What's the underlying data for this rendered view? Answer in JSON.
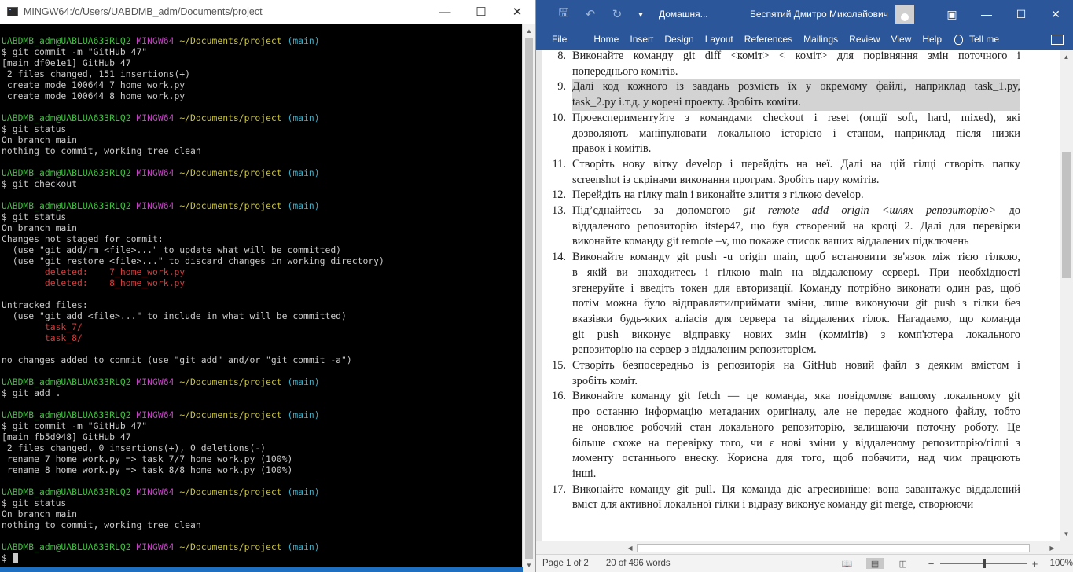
{
  "terminal": {
    "title": "MINGW64:/c/Users/UABDMB_adm/Documents/project",
    "lines": [
      [
        {
          "t": "UABDMB_adm@UABLUA633RLQ2 ",
          "c": "green"
        },
        {
          "t": "MINGW64 ",
          "c": "magenta"
        },
        {
          "t": "~/Documents/project ",
          "c": "yellow"
        },
        {
          "t": "(main)",
          "c": "cyan"
        }
      ],
      [
        {
          "t": "$ git commit -m \"GitHub_47\""
        }
      ],
      [
        {
          "t": "[main df0e1e1] GitHub_47"
        }
      ],
      [
        {
          "t": " 2 files changed, 151 insertions(+)"
        }
      ],
      [
        {
          "t": " create mode 100644 7_home_work.py"
        }
      ],
      [
        {
          "t": " create mode 100644 8_home_work.py"
        }
      ],
      [
        {
          "t": ""
        }
      ],
      [
        {
          "t": "UABDMB_adm@UABLUA633RLQ2 ",
          "c": "green"
        },
        {
          "t": "MINGW64 ",
          "c": "magenta"
        },
        {
          "t": "~/Documents/project ",
          "c": "yellow"
        },
        {
          "t": "(main)",
          "c": "cyan"
        }
      ],
      [
        {
          "t": "$ git status"
        }
      ],
      [
        {
          "t": "On branch main"
        }
      ],
      [
        {
          "t": "nothing to commit, working tree clean"
        }
      ],
      [
        {
          "t": ""
        }
      ],
      [
        {
          "t": "UABDMB_adm@UABLUA633RLQ2 ",
          "c": "green"
        },
        {
          "t": "MINGW64 ",
          "c": "magenta"
        },
        {
          "t": "~/Documents/project ",
          "c": "yellow"
        },
        {
          "t": "(main)",
          "c": "cyan"
        }
      ],
      [
        {
          "t": "$ git checkout"
        }
      ],
      [
        {
          "t": ""
        }
      ],
      [
        {
          "t": "UABDMB_adm@UABLUA633RLQ2 ",
          "c": "green"
        },
        {
          "t": "MINGW64 ",
          "c": "magenta"
        },
        {
          "t": "~/Documents/project ",
          "c": "yellow"
        },
        {
          "t": "(main)",
          "c": "cyan"
        }
      ],
      [
        {
          "t": "$ git status"
        }
      ],
      [
        {
          "t": "On branch main"
        }
      ],
      [
        {
          "t": "Changes not staged for commit:"
        }
      ],
      [
        {
          "t": "  (use \"git add/rm <file>...\" to update what will be committed)"
        }
      ],
      [
        {
          "t": "  (use \"git restore <file>...\" to discard changes in working directory)"
        }
      ],
      [
        {
          "t": "        deleted:    7_home_work.py",
          "c": "red"
        }
      ],
      [
        {
          "t": "        deleted:    8_home_work.py",
          "c": "red"
        }
      ],
      [
        {
          "t": ""
        }
      ],
      [
        {
          "t": "Untracked files:"
        }
      ],
      [
        {
          "t": "  (use \"git add <file>...\" to include in what will be committed)"
        }
      ],
      [
        {
          "t": "        task_7/",
          "c": "red"
        }
      ],
      [
        {
          "t": "        task_8/",
          "c": "red"
        }
      ],
      [
        {
          "t": ""
        }
      ],
      [
        {
          "t": "no changes added to commit (use \"git add\" and/or \"git commit -a\")"
        }
      ],
      [
        {
          "t": ""
        }
      ],
      [
        {
          "t": "UABDMB_adm@UABLUA633RLQ2 ",
          "c": "green"
        },
        {
          "t": "MINGW64 ",
          "c": "magenta"
        },
        {
          "t": "~/Documents/project ",
          "c": "yellow"
        },
        {
          "t": "(main)",
          "c": "cyan"
        }
      ],
      [
        {
          "t": "$ git add ."
        }
      ],
      [
        {
          "t": ""
        }
      ],
      [
        {
          "t": "UABDMB_adm@UABLUA633RLQ2 ",
          "c": "green"
        },
        {
          "t": "MINGW64 ",
          "c": "magenta"
        },
        {
          "t": "~/Documents/project ",
          "c": "yellow"
        },
        {
          "t": "(main)",
          "c": "cyan"
        }
      ],
      [
        {
          "t": "$ git commit -m \"GitHub_47\""
        }
      ],
      [
        {
          "t": "[main fb5d948] GitHub_47"
        }
      ],
      [
        {
          "t": " 2 files changed, 0 insertions(+), 0 deletions(-)"
        }
      ],
      [
        {
          "t": " rename 7_home_work.py => task_7/7_home_work.py (100%)"
        }
      ],
      [
        {
          "t": " rename 8_home_work.py => task_8/8_home_work.py (100%)"
        }
      ],
      [
        {
          "t": ""
        }
      ],
      [
        {
          "t": "UABDMB_adm@UABLUA633RLQ2 ",
          "c": "green"
        },
        {
          "t": "MINGW64 ",
          "c": "magenta"
        },
        {
          "t": "~/Documents/project ",
          "c": "yellow"
        },
        {
          "t": "(main)",
          "c": "cyan"
        }
      ],
      [
        {
          "t": "$ git status"
        }
      ],
      [
        {
          "t": "On branch main"
        }
      ],
      [
        {
          "t": "nothing to commit, working tree clean"
        }
      ],
      [
        {
          "t": ""
        }
      ],
      [
        {
          "t": "UABDMB_adm@UABLUA633RLQ2 ",
          "c": "green"
        },
        {
          "t": "MINGW64 ",
          "c": "magenta"
        },
        {
          "t": "~/Documents/project ",
          "c": "yellow"
        },
        {
          "t": "(main)",
          "c": "cyan"
        }
      ],
      [
        {
          "t": "$ ",
          "cursor": true
        }
      ]
    ]
  },
  "word": {
    "doc_title": "Домашня...",
    "user_name": "Беспятий Дмитро Миколайович",
    "tabs": [
      "File",
      "Home",
      "Insert",
      "Design",
      "Layout",
      "References",
      "Mailings",
      "Review",
      "View",
      "Help"
    ],
    "tell_me": "Tell me",
    "items": [
      {
        "num": "8.",
        "lines": [
          "Виконайте команду git diff  <коміт> < коміт> для порівняння змін поточного і",
          "попереднього комітів."
        ]
      },
      {
        "num": "9.",
        "highlight": true,
        "lines": [
          "Далі код кожного із завдань розмість їх у окремому файлі, наприклад  task_1.py,",
          "task_2.py і.т.д. у корені проекту. Зробіть коміти."
        ]
      },
      {
        "num": "10.",
        "lines": [
          "Проекспериментуйте з командами checkout і reset (опції soft, hard, mixed), які",
          "дозволяють маніпулювати локальною історією і станом, наприклад після низки",
          "правок і комітів."
        ]
      },
      {
        "num": "11.",
        "lines": [
          "Створіть нову вітку develop і перейдіть на неї. Далі на цій гілці створіть папку",
          "screenshot із скрінами виконання програм. Зробіть пару комітів."
        ]
      },
      {
        "num": "12.",
        "lines": [
          "Перейдіть на гілку main і виконайте злиття з гілкою develop."
        ]
      },
      {
        "num": "13.",
        "lines": [
          "Під’єднайтесь за допомогою <i>git remote add origin &lt;шлях репозиторію&gt;</i> до",
          "віддаленого репозиторію itstep47, що був створений на кроці 2. Далі для перевірки",
          "виконайте команду git remote –v, що покаже список ваших віддалених підключень"
        ]
      },
      {
        "num": "14.",
        "lines": [
          "Виконайте команду git push -u origin main,  щоб встановити зв'язок між тією гілкою,",
          "в якій ви знаходитесь і гілкою main на віддаленому сервері. При необхідності",
          "згенеруйте і введіть токен для авторизації. Команду потрібно виконати один раз, щоб",
          "потім можна було відправляти/приймати зміни, лише виконуючи git push з гілки без",
          "вказівки будь-яких аліасів для сервера та віддалених гілок. Нагадаємо, що команда",
          "git push виконує відправку нових змін (коммітів) з комп'ютера локального",
          "репозиторію на сервер з віддаленим репозиторієм."
        ]
      },
      {
        "num": "15.",
        "lines": [
          "Створіть безпосередньо із репозиторія на GitHub новий файл з деяким вмістом і",
          "зробіть коміт."
        ]
      },
      {
        "num": "16.",
        "lines": [
          "Виконайте команду git fetch — це команда, яка повідомляє вашому локальному git",
          "про останню інформацію метаданих оригіналу, але не передає жодного файлу, тобто",
          "не оновлює робочий стан локального репозиторію, залишаючи поточну роботу. Це",
          "більше схоже на перевірку того, чи є нові зміни у віддаленому репозиторію/гілці з",
          "моменту останнього внеску. Корисна для того, щоб побачити, над чим працюють",
          "інші."
        ]
      },
      {
        "num": "17.",
        "lines": [
          "Виконайте команду git pull. Ця команда діє агресивніше: вона завантажує віддалений",
          "вміст для активної локальної гілки і відразу виконує команду git merge, створюючи"
        ]
      }
    ],
    "status": {
      "page": "Page 1 of 2",
      "words": "20 of 496 words",
      "zoom": "100%",
      "zoom_level_percent": 100
    }
  },
  "colors": {
    "word_blue": "#2b579a",
    "term_green": "#3fbf3f",
    "term_magenta": "#c640c6",
    "term_yellow": "#c7c23c",
    "term_cyan": "#3aaec9",
    "term_red": "#d43d3d"
  }
}
